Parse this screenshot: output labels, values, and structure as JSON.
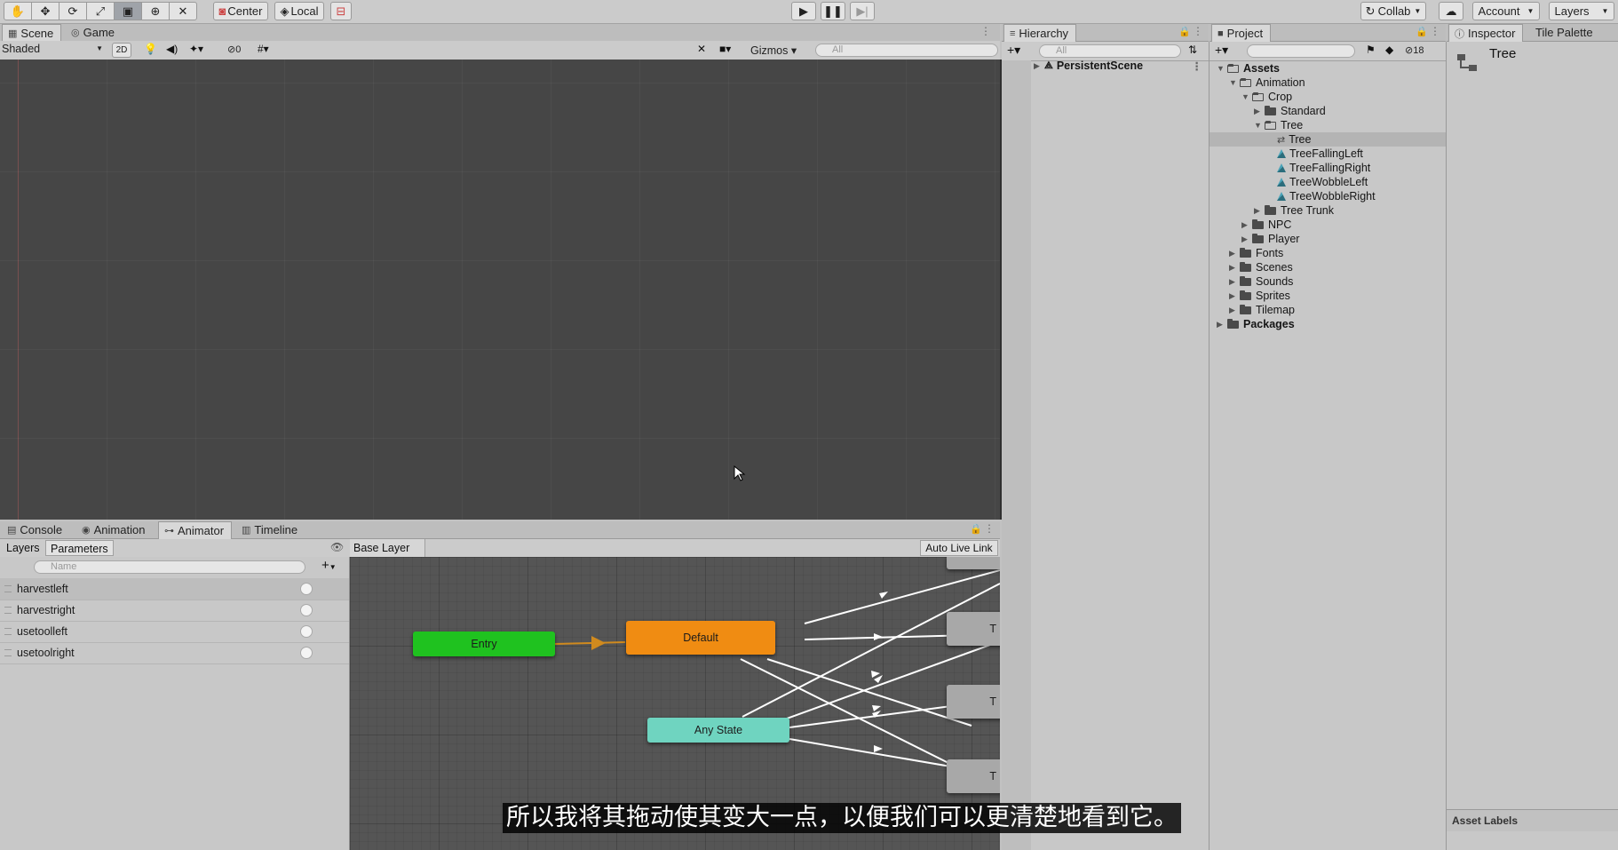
{
  "toolbar": {
    "pivot_center": "Center",
    "pivot_local": "Local",
    "collab": "Collab",
    "account": "Account",
    "layers": "Layers"
  },
  "scene_panel": {
    "tabs": [
      "Scene",
      "Game"
    ],
    "shading_mode": "Shaded",
    "mode_2d": "2D",
    "hidden_count": "0",
    "gizmos": "Gizmos",
    "search_placeholder": "All"
  },
  "hierarchy": {
    "tab": "Hierarchy",
    "search_placeholder": "All",
    "scene": "PersistentScene"
  },
  "project": {
    "tab": "Project",
    "badge_count": "18",
    "items": [
      {
        "label": "Assets",
        "depth": 0,
        "arrow": "▼",
        "kind": "folder-open",
        "bold": true
      },
      {
        "label": "Animation",
        "depth": 1,
        "arrow": "▼",
        "kind": "folder-open"
      },
      {
        "label": "Crop",
        "depth": 2,
        "arrow": "▼",
        "kind": "folder-open"
      },
      {
        "label": "Standard",
        "depth": 3,
        "arrow": "▶",
        "kind": "folder"
      },
      {
        "label": "Tree",
        "depth": 3,
        "arrow": "▼",
        "kind": "folder-open"
      },
      {
        "label": "Tree",
        "depth": 4,
        "arrow": "",
        "kind": "controller",
        "selected": true
      },
      {
        "label": "TreeFallingLeft",
        "depth": 4,
        "arrow": "",
        "kind": "clip"
      },
      {
        "label": "TreeFallingRight",
        "depth": 4,
        "arrow": "",
        "kind": "clip"
      },
      {
        "label": "TreeWobbleLeft",
        "depth": 4,
        "arrow": "",
        "kind": "clip"
      },
      {
        "label": "TreeWobbleRight",
        "depth": 4,
        "arrow": "",
        "kind": "clip"
      },
      {
        "label": "Tree Trunk",
        "depth": 3,
        "arrow": "▶",
        "kind": "folder"
      },
      {
        "label": "NPC",
        "depth": 2,
        "arrow": "▶",
        "kind": "folder"
      },
      {
        "label": "Player",
        "depth": 2,
        "arrow": "▶",
        "kind": "folder"
      },
      {
        "label": "Fonts",
        "depth": 1,
        "arrow": "▶",
        "kind": "folder"
      },
      {
        "label": "Scenes",
        "depth": 1,
        "arrow": "▶",
        "kind": "folder"
      },
      {
        "label": "Sounds",
        "depth": 1,
        "arrow": "▶",
        "kind": "folder"
      },
      {
        "label": "Sprites",
        "depth": 1,
        "arrow": "▶",
        "kind": "folder"
      },
      {
        "label": "Tilemap",
        "depth": 1,
        "arrow": "▶",
        "kind": "folder"
      },
      {
        "label": "Packages",
        "depth": 0,
        "arrow": "▶",
        "kind": "folder",
        "bold": true
      }
    ]
  },
  "inspector": {
    "tabs": [
      "Inspector",
      "Tile Palette"
    ],
    "object_name": "Tree",
    "asset_labels": "Asset Labels"
  },
  "bottom_panel": {
    "tabs": [
      "Console",
      "Animation",
      "Animator",
      "Timeline"
    ],
    "sub_tabs": [
      "Layers",
      "Parameters"
    ],
    "search_placeholder": "Name",
    "breadcrumb": "Base Layer",
    "auto_live_link": "Auto Live Link",
    "parameters": [
      "harvestleft",
      "harvestright",
      "usetoolleft",
      "usetoolright"
    ]
  },
  "animator_graph": {
    "nodes": [
      {
        "label": "Entry",
        "color": "#1fc21f"
      },
      {
        "label": "Default",
        "color": "#f08c12"
      },
      {
        "label": "Any State",
        "color": "#6fd4c0"
      },
      {
        "label": "T",
        "color": "#a8a8a8"
      },
      {
        "label": "T",
        "color": "#a8a8a8"
      },
      {
        "label": "T",
        "color": "#a8a8a8"
      }
    ]
  },
  "subtitle": "所以我将其拖动使其变大一点，以便我们可以更清楚地看到它。"
}
